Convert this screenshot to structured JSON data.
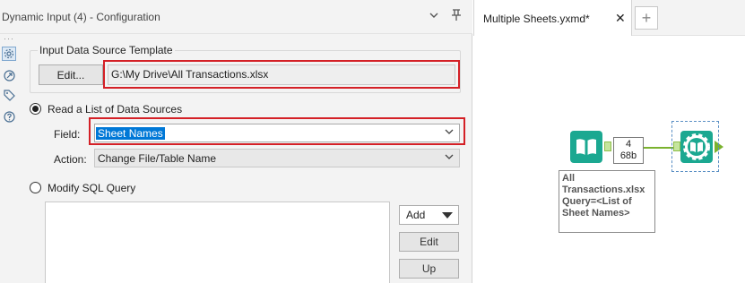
{
  "config_panel": {
    "title": "Dynamic Input (4) - Configuration",
    "icons": [
      "chevron-down-icon",
      "pin-icon"
    ],
    "strip_icons": [
      "gear-icon",
      "connection-icon",
      "tag-icon",
      "help-icon"
    ]
  },
  "input_template": {
    "legend": "Input Data Source Template",
    "edit_label": "Edit...",
    "path": "G:\\My Drive\\All Transactions.xlsx"
  },
  "options": {
    "read_list_label": "Read a List of Data Sources",
    "field_label": "Field:",
    "field_value": "Sheet Names",
    "action_label": "Action:",
    "action_value": "Change File/Table Name",
    "modify_sql_label": "Modify SQL Query",
    "selected_option": "read_list"
  },
  "sql_buttons": {
    "add": "Add",
    "edit": "Edit",
    "up": "Up"
  },
  "canvas": {
    "tab_title": "Multiple Sheets.yxmd*",
    "close_glyph": "✕",
    "add_tab_glyph": "+",
    "record_count": "4",
    "size": "68b",
    "tool_label_lines": [
      "All",
      "Transactions.xlsx",
      "Query=<List of",
      "Sheet Names>"
    ]
  },
  "colors": {
    "highlight_red": "#d42026",
    "tool_teal": "#1ba891",
    "connection_green": "#7ab22e",
    "selection_blue": "#0078d7"
  }
}
